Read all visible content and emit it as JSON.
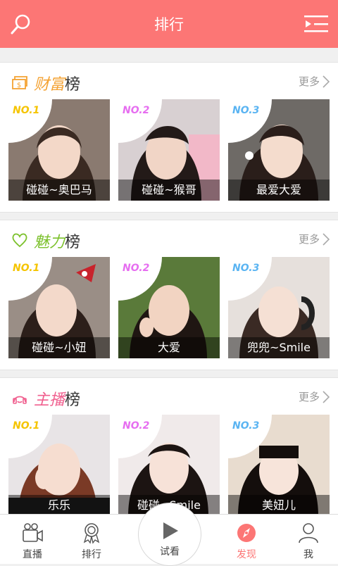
{
  "header": {
    "title": "排行"
  },
  "colors": {
    "brand": "#fc7675",
    "no1": "#f5c400",
    "no2": "#e66ef0",
    "no3": "#5ab4f2"
  },
  "sections": [
    {
      "title_main": "财富",
      "title_suffix": "榜",
      "title_color": "#f4a233",
      "icon": "money-icon",
      "more": "更多",
      "cards": [
        {
          "rank": "NO.1",
          "name": "碰碰~奥巴马"
        },
        {
          "rank": "NO.2",
          "name": "碰碰~猴哥"
        },
        {
          "rank": "NO.3",
          "name": "最爱大爱"
        }
      ]
    },
    {
      "title_main": "魅力",
      "title_suffix": "榜",
      "title_color": "#7cc12c",
      "icon": "heart-icon",
      "more": "更多",
      "cards": [
        {
          "rank": "NO.1",
          "name": "碰碰~小妞"
        },
        {
          "rank": "NO.2",
          "name": "大爱"
        },
        {
          "rank": "NO.3",
          "name": "兜兜~Smile"
        }
      ]
    },
    {
      "title_main": "主播",
      "title_suffix": "榜",
      "title_color": "#f0608f",
      "icon": "anchor-icon",
      "more": "更多",
      "cards": [
        {
          "rank": "NO.1",
          "name": "乐乐"
        },
        {
          "rank": "NO.2",
          "name": "碰碰~Smile"
        },
        {
          "rank": "NO.3",
          "name": "美妞儿"
        }
      ]
    }
  ],
  "tabs": [
    {
      "label": "直播",
      "icon": "camera-icon"
    },
    {
      "label": "排行",
      "icon": "medal-icon"
    },
    {
      "label": "试看",
      "icon": "play-icon"
    },
    {
      "label": "发现",
      "icon": "compass-icon"
    },
    {
      "label": "我",
      "icon": "user-icon"
    }
  ]
}
